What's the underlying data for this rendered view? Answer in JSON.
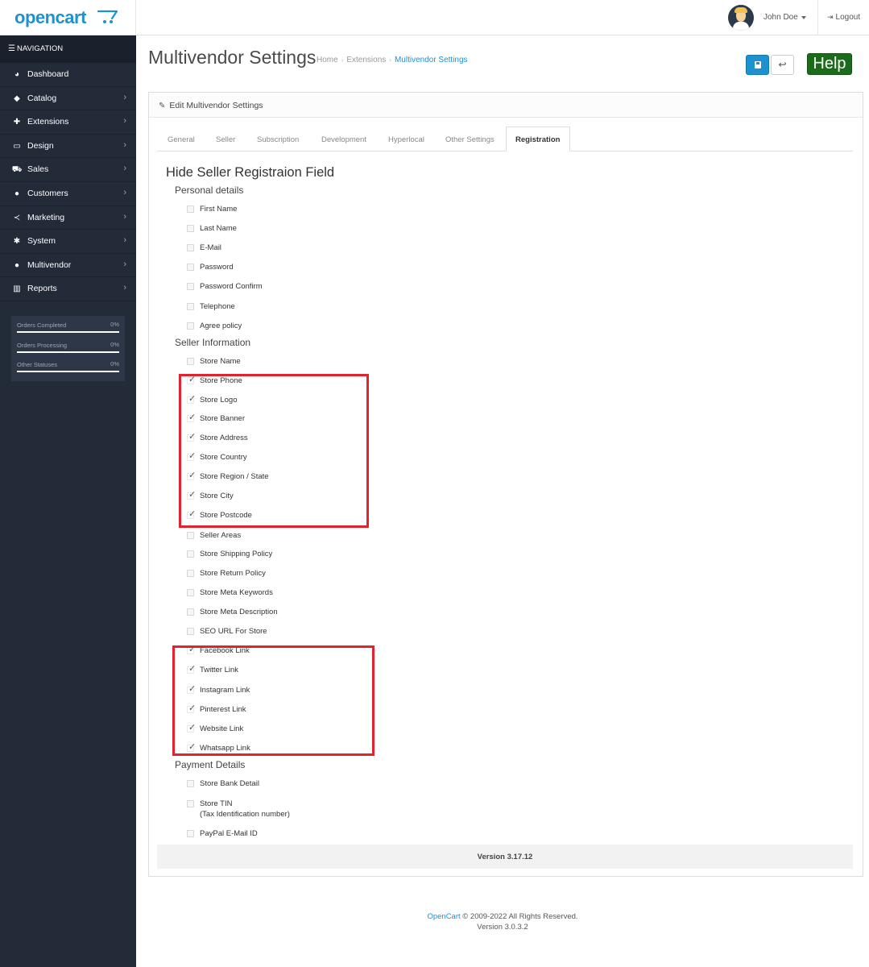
{
  "header": {
    "logo": "opencart",
    "user_name": "John Doe",
    "logout_label": "Logout"
  },
  "sidebar": {
    "nav_heading": "NAVIGATION",
    "items": [
      {
        "label": "Dashboard",
        "icon": "dashboard-icon"
      },
      {
        "label": "Catalog",
        "icon": "tag-icon"
      },
      {
        "label": "Extensions",
        "icon": "puzzle-icon"
      },
      {
        "label": "Design",
        "icon": "monitor-icon"
      },
      {
        "label": "Sales",
        "icon": "cart-icon"
      },
      {
        "label": "Customers",
        "icon": "user-icon"
      },
      {
        "label": "Marketing",
        "icon": "share-icon"
      },
      {
        "label": "System",
        "icon": "gear-icon"
      },
      {
        "label": "Multivendor",
        "icon": "user-icon"
      },
      {
        "label": "Reports",
        "icon": "bar-chart-icon"
      }
    ],
    "stats": [
      {
        "label": "Orders Completed",
        "value": "0%"
      },
      {
        "label": "Orders Processing",
        "value": "0%"
      },
      {
        "label": "Other Statuses",
        "value": "0%"
      }
    ]
  },
  "page": {
    "title": "Multivendor Settings",
    "breadcrumb": [
      "Home",
      "Extensions",
      "Multivendor Settings"
    ],
    "help_label": "Help"
  },
  "panel": {
    "heading": "Edit Multivendor Settings",
    "tabs": [
      "General",
      "Seller",
      "Subscription",
      "Development",
      "Hyperlocal",
      "Other Settings",
      "Registration"
    ],
    "active_tab": "Registration",
    "section_title": "Hide Seller Registraion Field",
    "groups": [
      {
        "title": "Personal details",
        "fields": [
          {
            "label": "First Name",
            "checked": false
          },
          {
            "label": "Last Name",
            "checked": false
          },
          {
            "label": "E-Mail",
            "checked": false
          },
          {
            "label": "Password",
            "checked": false
          },
          {
            "label": "Password Confirm",
            "checked": false
          },
          {
            "label": "Telephone",
            "checked": false
          },
          {
            "label": "Agree policy",
            "checked": false
          }
        ]
      },
      {
        "title": "Seller Information",
        "fields": [
          {
            "label": "Store Name",
            "checked": false
          },
          {
            "label": "Store Phone",
            "checked": true
          },
          {
            "label": "Store Logo",
            "checked": true
          },
          {
            "label": "Store Banner",
            "checked": true
          },
          {
            "label": "Store Address",
            "checked": true
          },
          {
            "label": "Store Country",
            "checked": true
          },
          {
            "label": "Store Region / State",
            "checked": true
          },
          {
            "label": "Store City",
            "checked": true
          },
          {
            "label": "Store Postcode",
            "checked": true
          },
          {
            "label": "Seller Areas",
            "checked": false
          },
          {
            "label": "Store Shipping Policy",
            "checked": false
          },
          {
            "label": "Store Return Policy",
            "checked": false
          },
          {
            "label": "Store Meta Keywords",
            "checked": false
          },
          {
            "label": "Store Meta Description",
            "checked": false
          },
          {
            "label": "SEO URL For Store",
            "checked": false
          },
          {
            "label": "Facebook Link",
            "checked": true
          },
          {
            "label": "Twitter Link",
            "checked": true
          },
          {
            "label": "Instagram Link",
            "checked": true
          },
          {
            "label": "Pinterest Link",
            "checked": true
          },
          {
            "label": "Website Link",
            "checked": true
          },
          {
            "label": "Whatsapp Link",
            "checked": true
          }
        ]
      },
      {
        "title": "Payment Details",
        "fields": [
          {
            "label": "Store Bank Detail",
            "checked": false
          },
          {
            "label": "Store TIN",
            "sub": "(Tax Identification number)",
            "checked": false
          },
          {
            "label": "PayPal E-Mail ID",
            "checked": false
          }
        ]
      }
    ],
    "version": "Version 3.17.12"
  },
  "footer": {
    "link": "OpenCart",
    "copyright": "© 2009-2022 All Rights Reserved.",
    "version": "Version 3.0.3.2"
  }
}
